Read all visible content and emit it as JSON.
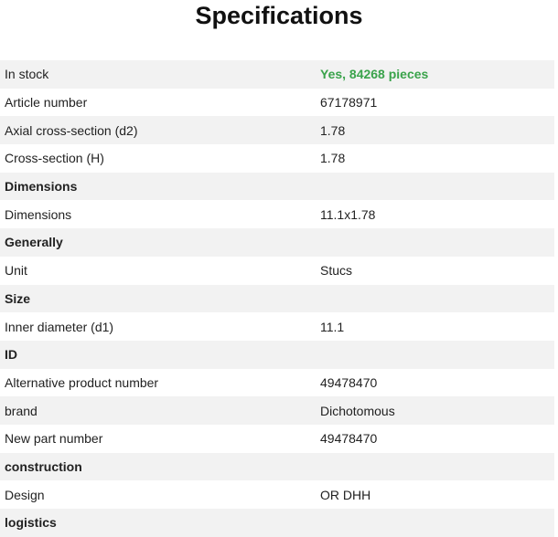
{
  "page": {
    "title": "Specifications"
  },
  "colors": {
    "stock_green": "#3aa34b",
    "row_shade": "#f2f2f2"
  },
  "specs": [
    {
      "label": "In stock",
      "value": "Yes, 84268 pieces",
      "kind": "stock"
    },
    {
      "label": "Article number",
      "value": "67178971",
      "kind": "row"
    },
    {
      "label": "Axial cross-section (d2)",
      "value": "1.78",
      "kind": "row"
    },
    {
      "label": "Cross-section (H)",
      "value": "1.78",
      "kind": "row"
    },
    {
      "label": "Dimensions",
      "value": "",
      "kind": "section"
    },
    {
      "label": "Dimensions",
      "value": "11.1x1.78",
      "kind": "row"
    },
    {
      "label": "Generally",
      "value": "",
      "kind": "section"
    },
    {
      "label": "Unit",
      "value": "Stucs",
      "kind": "row"
    },
    {
      "label": "Size",
      "value": "",
      "kind": "section"
    },
    {
      "label": "Inner diameter (d1)",
      "value": "11.1",
      "kind": "row"
    },
    {
      "label": "ID",
      "value": "",
      "kind": "section"
    },
    {
      "label": "Alternative product number",
      "value": "49478470",
      "kind": "row"
    },
    {
      "label": "brand",
      "value": "Dichotomous",
      "kind": "row"
    },
    {
      "label": "New part number",
      "value": "49478470",
      "kind": "row"
    },
    {
      "label": "construction",
      "value": "",
      "kind": "section"
    },
    {
      "label": "Design",
      "value": "OR DHH",
      "kind": "row"
    },
    {
      "label": "logistics",
      "value": "",
      "kind": "section"
    }
  ]
}
